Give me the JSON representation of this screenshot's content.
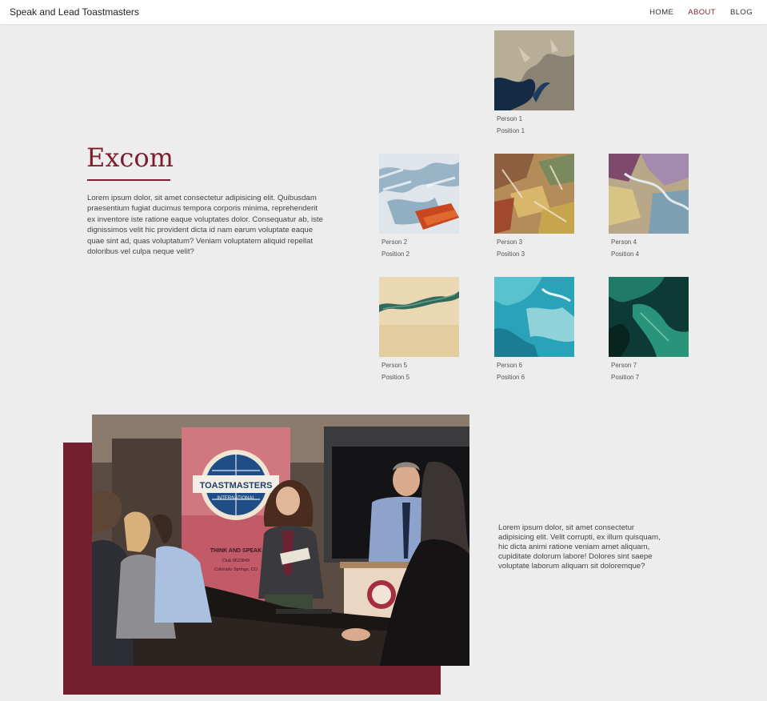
{
  "nav": {
    "brand": "Speak and Lead Toastmasters",
    "links": [
      {
        "label": "HOME",
        "active": false
      },
      {
        "label": "ABOUT",
        "active": true
      },
      {
        "label": "BLOG",
        "active": false
      }
    ]
  },
  "excom": {
    "title": "Excom",
    "description": "Lorem ipsum dolor, sit amet consectetur adipisicing elit. Quibusdam praesentium fugiat ducimus tempora corporis minima, reprehenderit ex inventore iste ratione eaque voluptates dolor. Consequatur ab, iste dignissimos velit hic provident dicta id nam earum voluptate eaque quae sint ad, quas voluptatum? Veniam voluptatem aliquid repellat doloribus vel culpa neque velit?"
  },
  "members": [
    {
      "name": "Person 1",
      "position": "Position 1"
    },
    {
      "name": "Person 2",
      "position": "Position 2"
    },
    {
      "name": "Person 3",
      "position": "Position 3"
    },
    {
      "name": "Person 4",
      "position": "Position 4"
    },
    {
      "name": "Person 5",
      "position": "Position 5"
    },
    {
      "name": "Person 6",
      "position": "Position 6"
    },
    {
      "name": "Person 7",
      "position": "Position 7"
    }
  ],
  "meeting": {
    "description": "Lorem ipsum dolor, sit amet consectetur adipisicing elit. Velit corrupti, ex illum quisquam, hic dicta animi ratione veniam amet aliquam, cupiditate dolorum labore! Dolores sint saepe voluptate laborum aliquam sit doloremque?",
    "banner_title": "TOASTMASTERS",
    "banner_subtitle": "INTERNATIONAL",
    "banner_slogan": "THINK AND SPEAK",
    "banner_club": "Club 9623849",
    "banner_city": "Colorado Springs, CO"
  },
  "colors": {
    "accent": "#751f2e",
    "background": "#ededed"
  }
}
